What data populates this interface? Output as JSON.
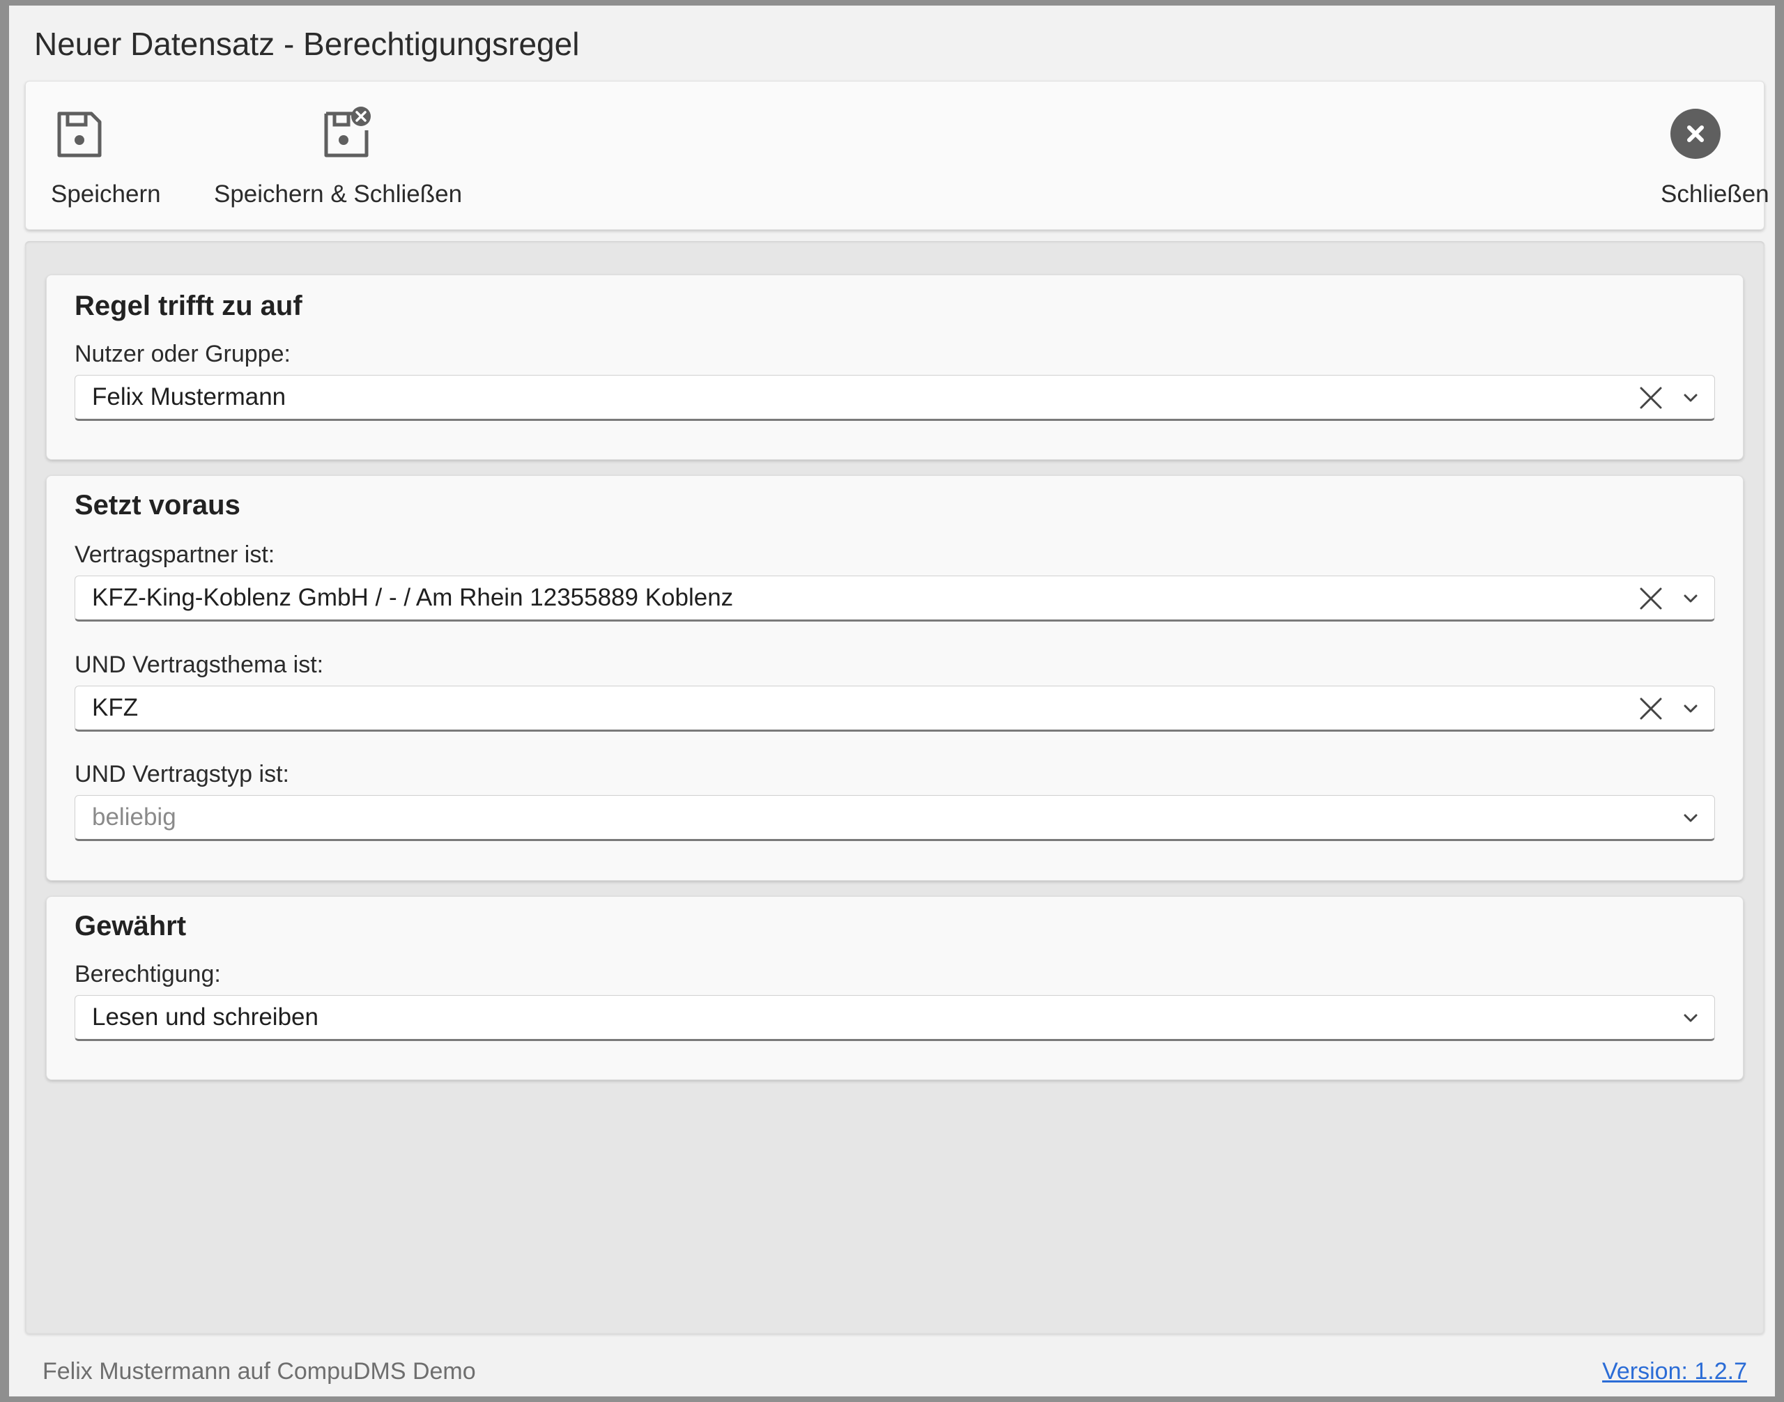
{
  "window": {
    "title": "Neuer Datensatz - Berechtigungsregel"
  },
  "toolbar": {
    "save_label": "Speichern",
    "save_close_label": "Speichern & Schließen",
    "close_label": "Schließen"
  },
  "sections": {
    "applies_to": {
      "title": "Regel trifft zu auf",
      "user_group_label": "Nutzer oder Gruppe:",
      "user_group_value": "Felix Mustermann"
    },
    "requires": {
      "title": "Setzt voraus",
      "partner_label": "Vertragspartner ist:",
      "partner_value": "KFZ-King-Koblenz GmbH / - / Am Rhein 12355889 Koblenz",
      "topic_label": "UND Vertragsthema ist:",
      "topic_value": "KFZ",
      "type_label": "UND Vertragstyp ist:",
      "type_placeholder": "beliebig"
    },
    "grants": {
      "title": "Gewährt",
      "permission_label": "Berechtigung:",
      "permission_value": "Lesen und schreiben"
    }
  },
  "footer": {
    "user_info": "Felix Mustermann auf CompuDMS Demo",
    "version_link": "Version: 1.2.7"
  },
  "icons": {
    "save": "save-icon",
    "save_close": "save-close-icon",
    "close": "close-circle-icon",
    "clear": "clear-x-icon",
    "dropdown": "chevron-down-icon"
  },
  "colors": {
    "link": "#2b6cd6",
    "icon_gray": "#5f5f5f"
  }
}
